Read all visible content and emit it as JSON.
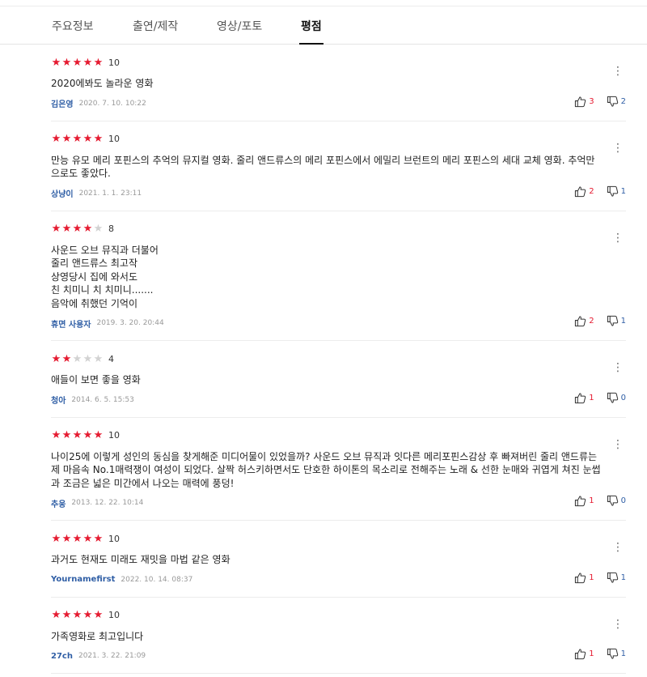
{
  "tabs": [
    {
      "label": "주요정보"
    },
    {
      "label": "출연/제작"
    },
    {
      "label": "영상/포토"
    },
    {
      "label": "평점"
    }
  ],
  "active_tab": "평점",
  "colors": {
    "star_on": "#e51a30",
    "star_off": "#d2d2d2",
    "user": "#2f5ea5",
    "like": "#e51a30",
    "dislike": "#2f5ea5"
  },
  "icons": {
    "more": "more-vertical-icon",
    "like": "thumbs-up-icon",
    "dislike": "thumbs-down-icon",
    "star": "star-icon"
  },
  "reviews": [
    {
      "stars": 5,
      "score": "10",
      "text": "2020에봐도 놀라운 영화",
      "user": "김은영",
      "date": "2020. 7. 10. 10:22",
      "likes": "3",
      "dislikes": "2"
    },
    {
      "stars": 5,
      "score": "10",
      "text": "만능 유모 메리 포핀스의 추억의 뮤지컬 영화.  줄리 앤드류스의 메리 포핀스에서  에밀리 브런트의 메리 포핀스의 세대 교체 영화. 추억만으로도 좋았다.",
      "user": "상냥이",
      "date": "2021. 1. 1. 23:11",
      "likes": "2",
      "dislikes": "1"
    },
    {
      "stars": 4,
      "score": "8",
      "text": "사운드 오브 뮤직과 더불어\n줄리 앤드류스 최고작\n상영당시 집에 와서도\n친 치미니 치 치미니.......\n음악에 취했던 기억이",
      "user": "휴면 사용자",
      "date": "2019. 3. 20. 20:44",
      "likes": "2",
      "dislikes": "1"
    },
    {
      "stars": 2,
      "score": "4",
      "text": "애들이 보면 좋을 영화",
      "user": "청아",
      "date": "2014. 6. 5. 15:53",
      "likes": "1",
      "dislikes": "0"
    },
    {
      "stars": 5,
      "score": "10",
      "text": "나이25에 이렇게 성인의 동심을 찾게해준 미디어물이 있었을까? 사운드 오브 뮤직과 잇다른 메리포핀스감상 후 빠져버린 줄리 앤드류는 제 마음속 No.1매력쟁이 여성이 되었다. 살짝 허스키하면서도 단호한 하이톤의 목소리로 전해주는 노래 & 선한 눈매와 귀엽게 쳐진 눈썹과 조금은 넓은 미간에서 나오는 매력에 풍덩!",
      "user": "추웅",
      "date": "2013. 12. 22. 10:14",
      "likes": "1",
      "dislikes": "0"
    },
    {
      "stars": 5,
      "score": "10",
      "text": "과거도 현재도 미래도 재밋을 마법 같은 영화",
      "user": "Yournamefirst",
      "date": "2022. 10. 14. 08:37",
      "likes": "1",
      "dislikes": "1"
    },
    {
      "stars": 5,
      "score": "10",
      "text": "가족영화로 최고입니다",
      "user": "27ch",
      "date": "2021. 3. 22. 21:09",
      "likes": "1",
      "dislikes": "1"
    }
  ]
}
